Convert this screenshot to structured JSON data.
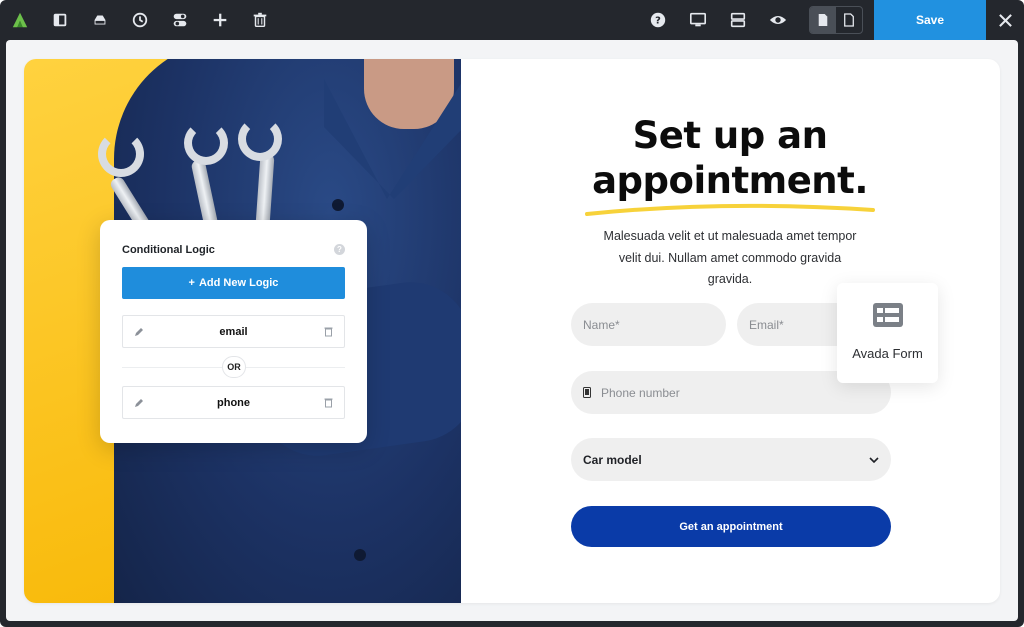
{
  "toolbar": {
    "left_icons": [
      "avada-logo-icon",
      "sidebar-panel-icon",
      "layers-icon",
      "history-icon",
      "toggle-icon",
      "add-icon",
      "trash-icon"
    ],
    "right_icons": [
      "help-icon",
      "desktop-preview-icon",
      "sections-icon",
      "preview-eye-icon"
    ],
    "save_label": "Save",
    "accent": "#2191e0"
  },
  "logic_panel": {
    "title": "Conditional Logic",
    "help": "?",
    "add_button": "Add New Logic",
    "rules": [
      {
        "label": "email"
      },
      {
        "label": "phone"
      }
    ],
    "operator": "OR"
  },
  "form": {
    "heading_line1": "Set up an",
    "heading_line2": "appointment.",
    "description": "Malesuada velit et ut malesuada amet tempor velit dui. Nullam amet commodo gravida gravida.",
    "name_placeholder": "Name*",
    "email_placeholder": "Email*",
    "phone_placeholder": "Phone number",
    "car_model": "Car model",
    "submit": "Get an appointment",
    "submit_color": "#0a3ba8"
  },
  "avada_card": {
    "label": "Avada Form"
  }
}
